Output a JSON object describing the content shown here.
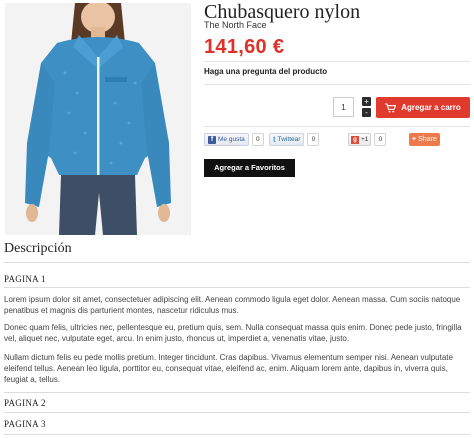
{
  "product": {
    "title": "Chubasquero nylon",
    "brand": "The North Face",
    "price": "141,60 €",
    "question_link": "Haga una pregunta del producto",
    "image_alt": "product-photo-jacket"
  },
  "cart": {
    "quantity": "1",
    "increment": "+",
    "decrement": "-",
    "add_to_cart": "Agregar a carro",
    "add_to_favorites": "Agregar a Favoritos"
  },
  "social": {
    "facebook_label": "Me gusta",
    "facebook_count": "0",
    "twitter_label": "Twittear",
    "twitter_count": "0",
    "gplus_label": "+1",
    "gplus_count": "0",
    "share_label": "Share",
    "share_plus": "+"
  },
  "description": {
    "heading": "Descripción",
    "sections": [
      {
        "label": "PAGINA 1"
      },
      {
        "label": "PAGINA 2"
      },
      {
        "label": "PAGINA 3"
      }
    ],
    "paragraphs": [
      "Lorem ipsum dolor sit amet, consectetuer adipiscing elit. Aenean commodo ligula eget dolor. Aenean massa. Cum sociis natoque penatibus et magnis dis parturient montes, nascetur ridiculus mus.",
      "Donec quam felis, ultricies nec, pellentesque eu, pretium quis, sem. Nulla consequat massa quis enim. Donec pede justo, fringilla vel, aliquet nec, vulputate eget, arcu. In enim justo, rhoncus ut, imperdiet a, venenatis vitae, justo.",
      "Nullam dictum felis eu pede mollis pretium. Integer tincidunt. Cras dapibus. Vivamus elementum semper nisi. Aenean vulputate eleifend tellus. Aenean leo ligula, porttitor eu, consequat vitae, eleifend ac, enim. Aliquam lorem ante, dapibus in, viverra quis, feugiat a, tellus."
    ]
  },
  "colors": {
    "price": "#e0302a",
    "cart_button": "#e0392e",
    "favorites_button": "#111111",
    "jacket": "#3d8fc4",
    "share": "#ed7a4c"
  },
  "icons": {
    "cart": "shopping-cart-icon",
    "facebook": "facebook-icon",
    "twitter": "twitter-icon",
    "gplus": "google-plus-icon"
  }
}
